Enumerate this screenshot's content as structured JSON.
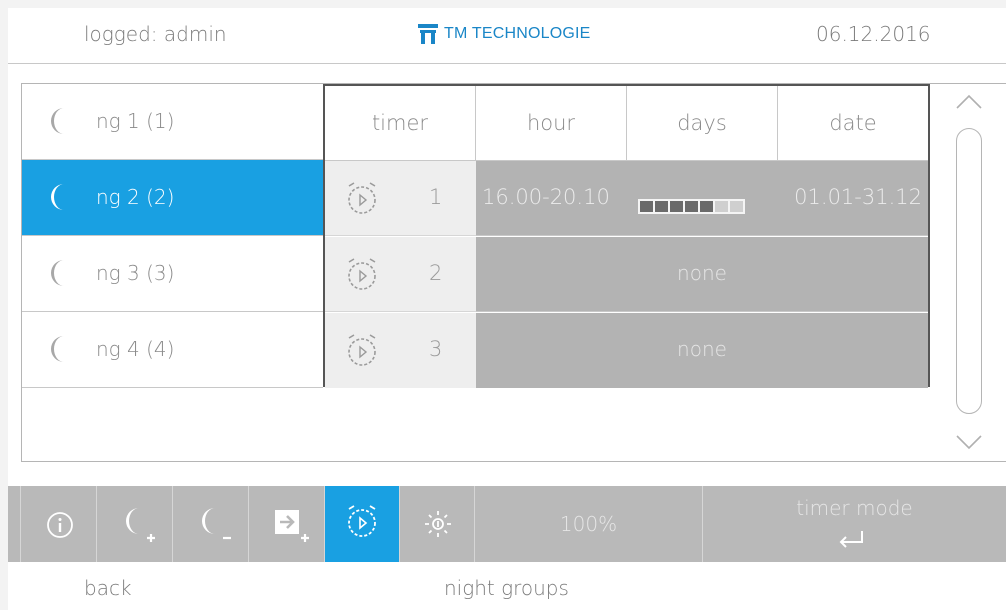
{
  "header": {
    "logged_in": "logged: admin",
    "brand": "TM TECHNOLOGIE",
    "date": "06.12.2016",
    "brand_color": "#1a86c7"
  },
  "groups": [
    {
      "label": "ng 1 (1)",
      "icon": "moon-icon",
      "selected": false
    },
    {
      "label": "ng 2 (2)",
      "icon": "moon-icon",
      "selected": true
    },
    {
      "label": "ng 3 (3)",
      "icon": "moon-icon",
      "selected": false
    },
    {
      "label": "ng 4 (4)",
      "icon": "moon-icon",
      "selected": false
    }
  ],
  "table": {
    "columns": [
      "timer",
      "hour",
      "days",
      "date"
    ],
    "rows": [
      {
        "timer": "1",
        "hour": "16.00-20.10",
        "days": [
          true,
          true,
          true,
          true,
          true,
          false,
          false
        ],
        "date": "01.01-31.12",
        "none": ""
      },
      {
        "timer": "2",
        "hour": "",
        "days": [],
        "date": "",
        "none": "none"
      },
      {
        "timer": "3",
        "hour": "",
        "days": [],
        "date": "",
        "none": "none"
      }
    ]
  },
  "toolbar": {
    "buttons": [
      {
        "name": "info-button",
        "icon": "info-icon"
      },
      {
        "name": "add-group-button",
        "icon": "moon-plus-icon"
      },
      {
        "name": "remove-group-button",
        "icon": "moon-minus-icon"
      },
      {
        "name": "add-to-group-button",
        "icon": "enter-plus-icon"
      },
      {
        "name": "timer-button",
        "icon": "alarm-clock-icon",
        "selected": true
      },
      {
        "name": "brightness-button",
        "icon": "sun-icon"
      }
    ],
    "level": "100%",
    "mode_label": "timer mode",
    "mode_icon": "enter-arrow-icon",
    "accent": "#19a0e2"
  },
  "footer": {
    "back": "back",
    "screen": "night groups"
  }
}
